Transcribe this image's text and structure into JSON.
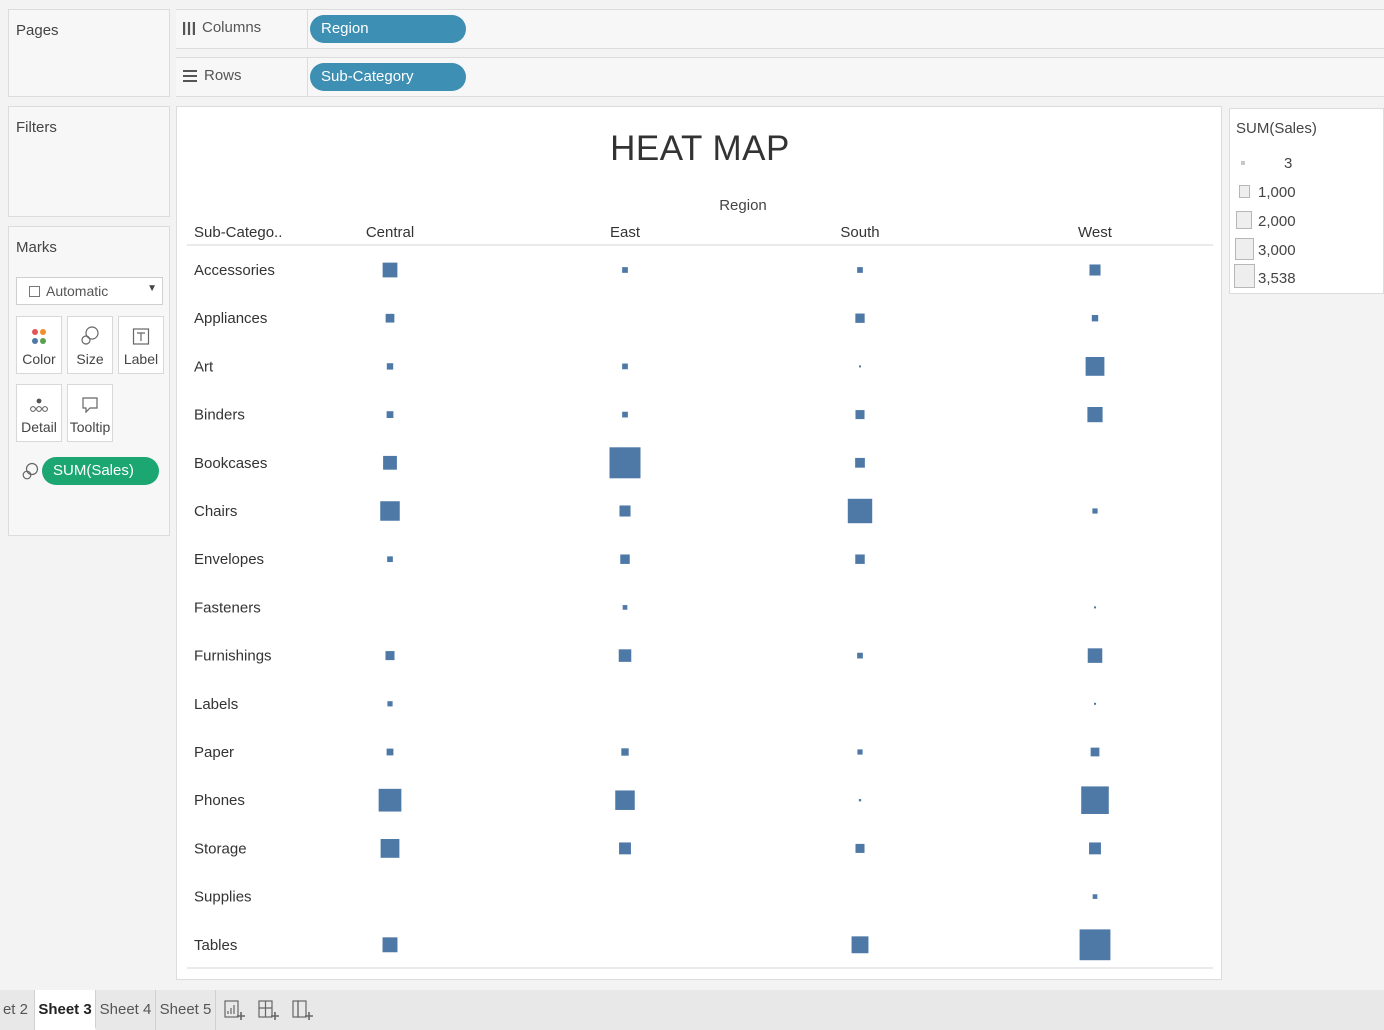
{
  "shelves": {
    "pages_label": "Pages",
    "filters_label": "Filters",
    "columns_label": "Columns",
    "rows_label": "Rows",
    "columns_pill": "Region",
    "rows_pill": "Sub-Category"
  },
  "marks": {
    "title": "Marks",
    "mark_type": "Automatic",
    "buttons": {
      "color": "Color",
      "size": "Size",
      "label": "Label",
      "detail": "Detail",
      "tooltip": "Tooltip"
    },
    "size_pill": "SUM(Sales)"
  },
  "legend": {
    "title": "SUM(Sales)",
    "entries": [
      "3",
      "1,000",
      "2,000",
      "3,000",
      "3,538"
    ]
  },
  "tabs": {
    "sheet2_partial": "et 2",
    "sheet3": "Sheet 3",
    "sheet4": "Sheet 4",
    "sheet5": "Sheet 5",
    "icons": [
      "new-worksheet-icon",
      "new-dashboard-icon",
      "new-story-icon"
    ]
  },
  "colors": {
    "mark": "#4e79a7",
    "pill_blue": "#3d8fb3",
    "pill_green": "#1ba672"
  },
  "chart_data": {
    "type": "heatmap",
    "title": "HEAT MAP",
    "xlabel": "Region",
    "row_header": "Sub-Catego..",
    "x": [
      "Central",
      "East",
      "South",
      "West"
    ],
    "y": [
      "Accessories",
      "Appliances",
      "Art",
      "Binders",
      "Bookcases",
      "Chairs",
      "Envelopes",
      "Fasteners",
      "Furnishings",
      "Labels",
      "Paper",
      "Phones",
      "Storage",
      "Supplies",
      "Tables"
    ],
    "values": [
      [
        800,
        120,
        120,
        450
      ],
      [
        280,
        null,
        320,
        150
      ],
      [
        150,
        120,
        8,
        1300
      ],
      [
        170,
        120,
        300,
        850
      ],
      [
        700,
        3538,
        350,
        null
      ],
      [
        1400,
        450,
        2200,
        100
      ],
      [
        120,
        330,
        330,
        null
      ],
      [
        null,
        80,
        null,
        10
      ],
      [
        300,
        580,
        120,
        780
      ],
      [
        100,
        null,
        null,
        5
      ],
      [
        170,
        200,
        100,
        280
      ],
      [
        1900,
        1400,
        20,
        2800
      ],
      [
        1300,
        520,
        300,
        520
      ],
      [
        null,
        null,
        null,
        80
      ],
      [
        820,
        null,
        1050,
        3500
      ]
    ],
    "size_legend": [
      3,
      1000,
      2000,
      3000,
      3538
    ],
    "grid": false
  }
}
